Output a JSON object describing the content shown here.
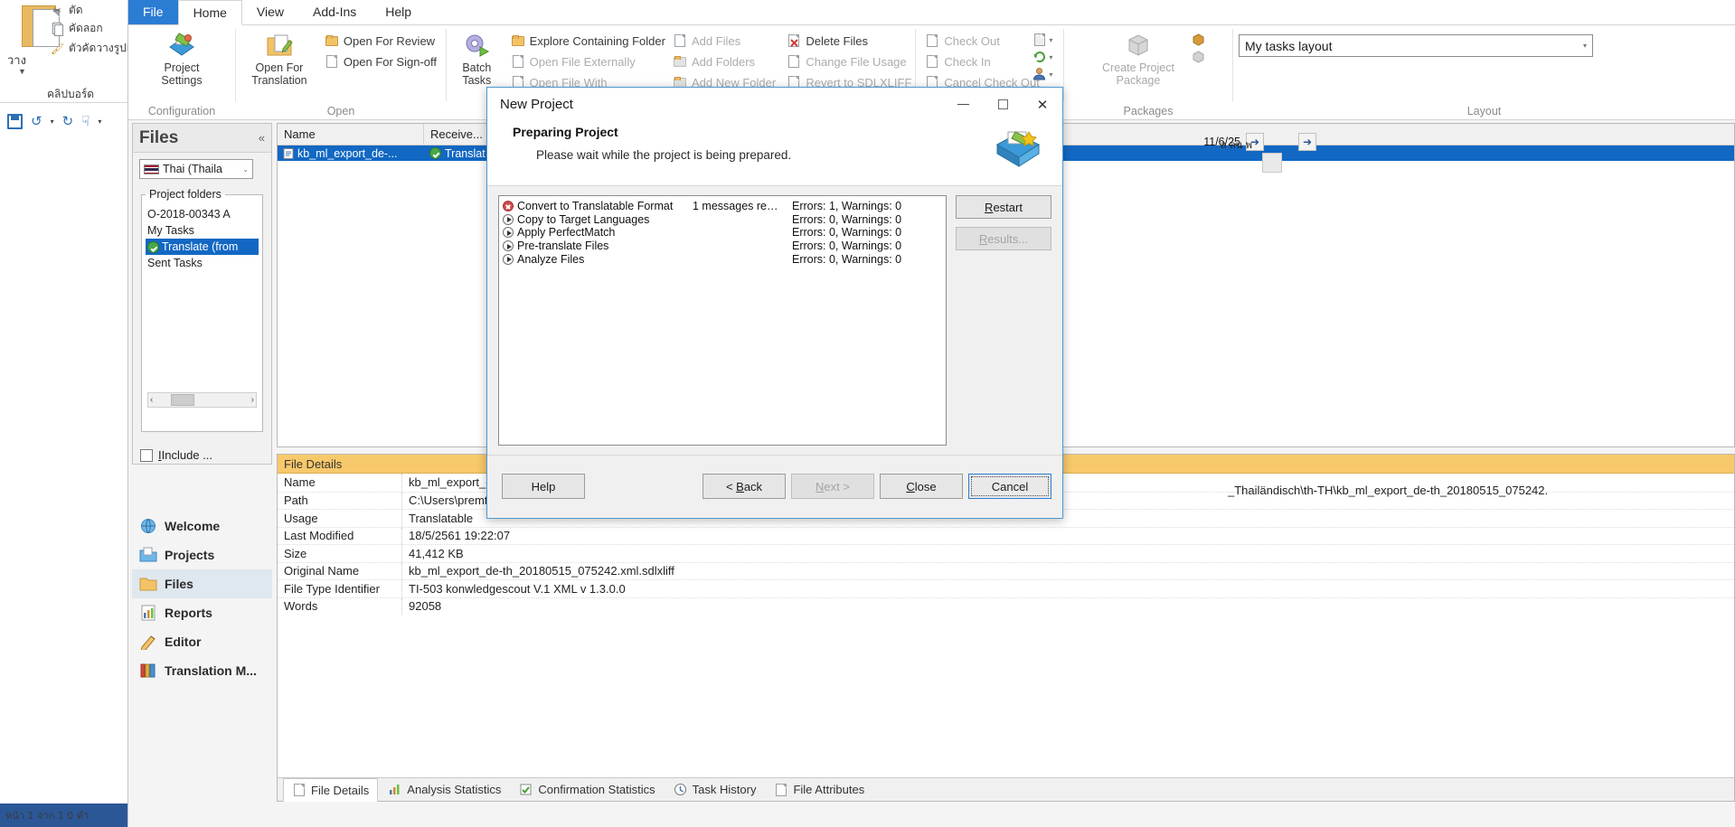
{
  "background_app": {
    "paste_label": "วาง",
    "cut_label": "ตัด",
    "copy_label": "คัดลอก",
    "format_painter_label": "ตัวคัดวางรูปแ",
    "clipboard_group": "คลิปบอร์ด",
    "status_text": "หน้า 1 จาก 1  0 คำ"
  },
  "ribbon": {
    "tabs": [
      {
        "label": "File",
        "state": "file"
      },
      {
        "label": "Home",
        "state": "active"
      },
      {
        "label": "View",
        "state": "normal"
      },
      {
        "label": "Add-Ins",
        "state": "normal"
      },
      {
        "label": "Help",
        "state": "normal"
      }
    ],
    "groups": {
      "configuration": {
        "title": "Configuration",
        "project_settings": "Project\nSettings"
      },
      "open": {
        "title": "Open",
        "open_for_translation": "Open For\nTranslation",
        "open_for_review": "Open For Review",
        "open_for_signoff": "Open For Sign-off"
      },
      "tasks": {
        "batch_tasks": "Batch\nTasks",
        "explore_containing_folder": "Explore Containing Folder",
        "open_file_externally": "Open File Externally",
        "open_file_with": "Open File With",
        "add_files": "Add Files",
        "add_folders": "Add Folders",
        "add_new_folder": "Add New Folder",
        "delete_files": "Delete Files",
        "change_file_usage": "Change File Usage",
        "revert_to_sdlxliff": "Revert to SDLXLIFF",
        "check_out": "Check Out",
        "check_in": "Check In",
        "cancel_check_out": "Cancel Check Out"
      },
      "packages": {
        "title": "Packages",
        "create_project_package": "Create Project\nPackage"
      },
      "layout": {
        "title": "Layout",
        "selected_layout": "My tasks layout"
      }
    }
  },
  "files_panel": {
    "title": "Files",
    "collapse_label": "«",
    "language_selected": "Thai (Thaila",
    "project_folders_legend": "Project folders",
    "tree": [
      {
        "label": "O-2018-00343 A",
        "selected": false,
        "has_check": false
      },
      {
        "label": "My Tasks",
        "selected": false,
        "has_check": false
      },
      {
        "label": "Translate (from",
        "selected": true,
        "has_check": true
      },
      {
        "label": "Sent Tasks",
        "selected": false,
        "has_check": false
      }
    ],
    "include_checkbox_label": "Include ...",
    "scroll_left": "‹",
    "scroll_right": "›"
  },
  "navigation": [
    {
      "label": "Welcome",
      "icon": "globe-icon",
      "active": false
    },
    {
      "label": "Projects",
      "icon": "projects-icon",
      "active": false
    },
    {
      "label": "Files",
      "icon": "folder-icon",
      "active": true
    },
    {
      "label": "Reports",
      "icon": "reports-icon",
      "active": false
    },
    {
      "label": "Editor",
      "icon": "pencil-icon",
      "active": false
    },
    {
      "label": "Translation M...",
      "icon": "books-icon",
      "active": false
    }
  ],
  "file_list": {
    "columns": [
      "Name",
      "Receive..."
    ],
    "rows": [
      {
        "name": "kb_ml_export_de-...",
        "received": "Translat",
        "selected": true
      }
    ],
    "date_cell": "11/6/25",
    "thai_cell": "ล ลน พ"
  },
  "file_details": {
    "title": "File Details",
    "rows": [
      {
        "key": "Name",
        "value": "kb_ml_export_de-"
      },
      {
        "key": "Path",
        "value": "C:\\Users\\premtans"
      },
      {
        "key": "Usage",
        "value": "Translatable"
      },
      {
        "key": "Last Modified",
        "value": "18/5/2561 19:22:07"
      },
      {
        "key": "Size",
        "value": "41,412 KB"
      },
      {
        "key": "Original Name",
        "value": "kb_ml_export_de-th_20180515_075242.xml.sdlxliff"
      },
      {
        "key": "File Type Identifier",
        "value": "TI-503 konwledgescout V.1 XML v 1.3.0.0"
      },
      {
        "key": "Words",
        "value": "92058"
      }
    ],
    "overflow_path": "_Thailändisch\\th-TH\\kb_ml_export_de-th_20180515_075242."
  },
  "bottom_tabs": [
    {
      "label": "File Details",
      "active": true
    },
    {
      "label": "Analysis Statistics",
      "active": false
    },
    {
      "label": "Confirmation Statistics",
      "active": false
    },
    {
      "label": "Task History",
      "active": false
    },
    {
      "label": "File Attributes",
      "active": false
    }
  ],
  "dialog": {
    "title": "New Project",
    "heading": "Preparing Project",
    "subheading": "Please wait while the project is being prepared.",
    "minimize_label": "—",
    "maximize_label": "□",
    "close_label": "✕",
    "tasks": [
      {
        "name": "Convert to Translatable Format",
        "status": "error",
        "messages": "1  messages re…",
        "errors": "Errors: 1, Warnings: 0"
      },
      {
        "name": "Copy to Target Languages",
        "status": "pending",
        "messages": "",
        "errors": "Errors: 0, Warnings: 0"
      },
      {
        "name": "Apply PerfectMatch",
        "status": "pending",
        "messages": "",
        "errors": "Errors: 0, Warnings: 0"
      },
      {
        "name": "Pre-translate Files",
        "status": "pending",
        "messages": "",
        "errors": "Errors: 0, Warnings: 0"
      },
      {
        "name": "Analyze Files",
        "status": "pending",
        "messages": "",
        "errors": "Errors: 0, Warnings: 0"
      }
    ],
    "side_buttons": [
      {
        "label": "Restart",
        "accesskey": "R",
        "disabled": false
      },
      {
        "label": "Results...",
        "accesskey": "R",
        "disabled": true
      }
    ],
    "footer_buttons": [
      {
        "label": "Help",
        "accesskey": "",
        "disabled": false,
        "focused": false
      },
      {
        "label": "< Back",
        "accesskey": "B",
        "disabled": false,
        "focused": false
      },
      {
        "label": "Next >",
        "accesskey": "N",
        "disabled": true,
        "focused": false
      },
      {
        "label": "Close",
        "accesskey": "C",
        "disabled": false,
        "focused": false
      },
      {
        "label": "Cancel",
        "accesskey": "",
        "disabled": false,
        "focused": true
      }
    ]
  },
  "colors": {
    "accent_blue": "#2b7cd3",
    "selection_blue": "#1268c3",
    "details_header": "#f8c96a",
    "error_red": "#d14a4a",
    "success_green": "#46a846"
  }
}
